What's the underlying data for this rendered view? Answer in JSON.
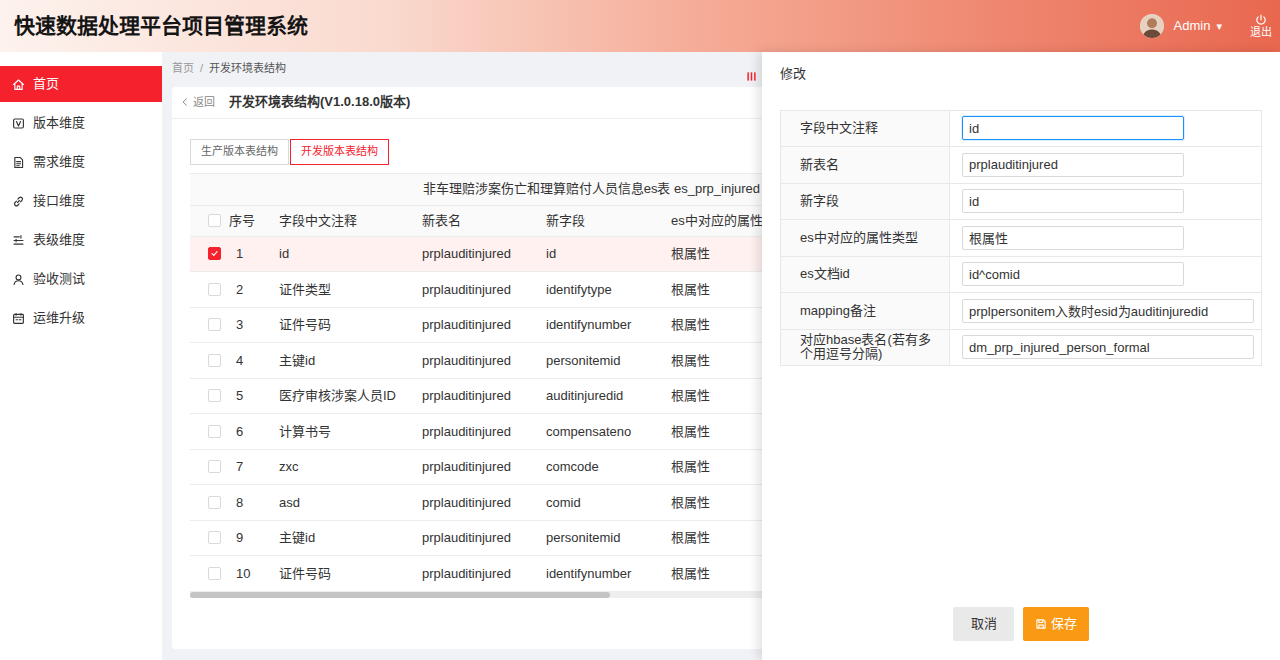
{
  "header": {
    "title": "快速数据处理平台项目管理系统",
    "user": "Admin",
    "caret": "▾",
    "logout": "退出"
  },
  "sidebar": {
    "items": [
      {
        "label": "首页",
        "selected": true
      },
      {
        "label": "版本维度",
        "selected": false
      },
      {
        "label": "需求维度",
        "selected": false
      },
      {
        "label": "接口维度",
        "selected": false
      },
      {
        "label": "表级维度",
        "selected": false
      },
      {
        "label": "验收测试",
        "selected": false
      },
      {
        "label": "运维升级",
        "selected": false
      }
    ]
  },
  "breadcrumb": {
    "items": [
      "首页",
      "开发环境表结构"
    ],
    "separator": "/"
  },
  "page": {
    "back": "返回",
    "title": "开发环境表结构(V1.0.18.0版本)"
  },
  "tabs": [
    {
      "label": "生产版本表结构",
      "selected": false
    },
    {
      "label": "开发版本表结构",
      "selected": true
    }
  ],
  "table": {
    "caption": "非车理赔涉案伤亡和理算赔付人员信息es表  es_prp_injured",
    "header_checked": false,
    "columns": [
      "序号",
      "字段中文注释",
      "新表名",
      "新字段",
      "es中对应的属性"
    ],
    "rows": [
      {
        "checked": true,
        "cells": [
          "1",
          "id",
          "prplauditinjured",
          "id",
          "根属性"
        ]
      },
      {
        "checked": false,
        "cells": [
          "2",
          "证件类型",
          "prplauditinjured",
          "identifytype",
          "根属性"
        ]
      },
      {
        "checked": false,
        "cells": [
          "3",
          "证件号码",
          "prplauditinjured",
          "identifynumber",
          "根属性"
        ]
      },
      {
        "checked": false,
        "cells": [
          "4",
          "主键id",
          "prplauditinjured",
          "personitemid",
          "根属性"
        ]
      },
      {
        "checked": false,
        "cells": [
          "5",
          "医疗审核涉案人员ID",
          "prplauditinjured",
          "auditinjuredid",
          "根属性"
        ]
      },
      {
        "checked": false,
        "cells": [
          "6",
          "计算书号",
          "prplauditinjured",
          "compensateno",
          "根属性"
        ]
      },
      {
        "checked": false,
        "cells": [
          "7",
          "zxc",
          "prplauditinjured",
          "comcode",
          "根属性"
        ]
      },
      {
        "checked": false,
        "cells": [
          "8",
          "asd",
          "prplauditinjured",
          "comid",
          "根属性"
        ]
      },
      {
        "checked": false,
        "cells": [
          "9",
          "主键id",
          "prplauditinjured",
          "personitemid",
          "根属性"
        ]
      },
      {
        "checked": false,
        "cells": [
          "10",
          "证件号码",
          "prplauditinjured",
          "identifynumber",
          "根属性"
        ]
      }
    ]
  },
  "drawer": {
    "title": "修改",
    "fields": [
      {
        "label": "字段中文注释",
        "value": "id",
        "focused": true
      },
      {
        "label": "新表名",
        "value": "prplauditinjured",
        "focused": false
      },
      {
        "label": "新字段",
        "value": "id",
        "focused": false
      },
      {
        "label": "es中对应的属性类型",
        "value": "根属性",
        "focused": false
      },
      {
        "label": "es文档id",
        "value": "id^comid",
        "focused": false
      },
      {
        "label": "mapping备注",
        "value": "prplpersonitem入数时esid为auditinjuredid",
        "focused": false
      },
      {
        "label": "对应hbase表名(若有多个用逗号分隔)",
        "value": "dm_prp_injured_person_formal",
        "focused": false
      }
    ],
    "buttons": [
      {
        "label": "取消",
        "kind": "cancel"
      },
      {
        "label": "保存",
        "kind": "save"
      }
    ]
  }
}
